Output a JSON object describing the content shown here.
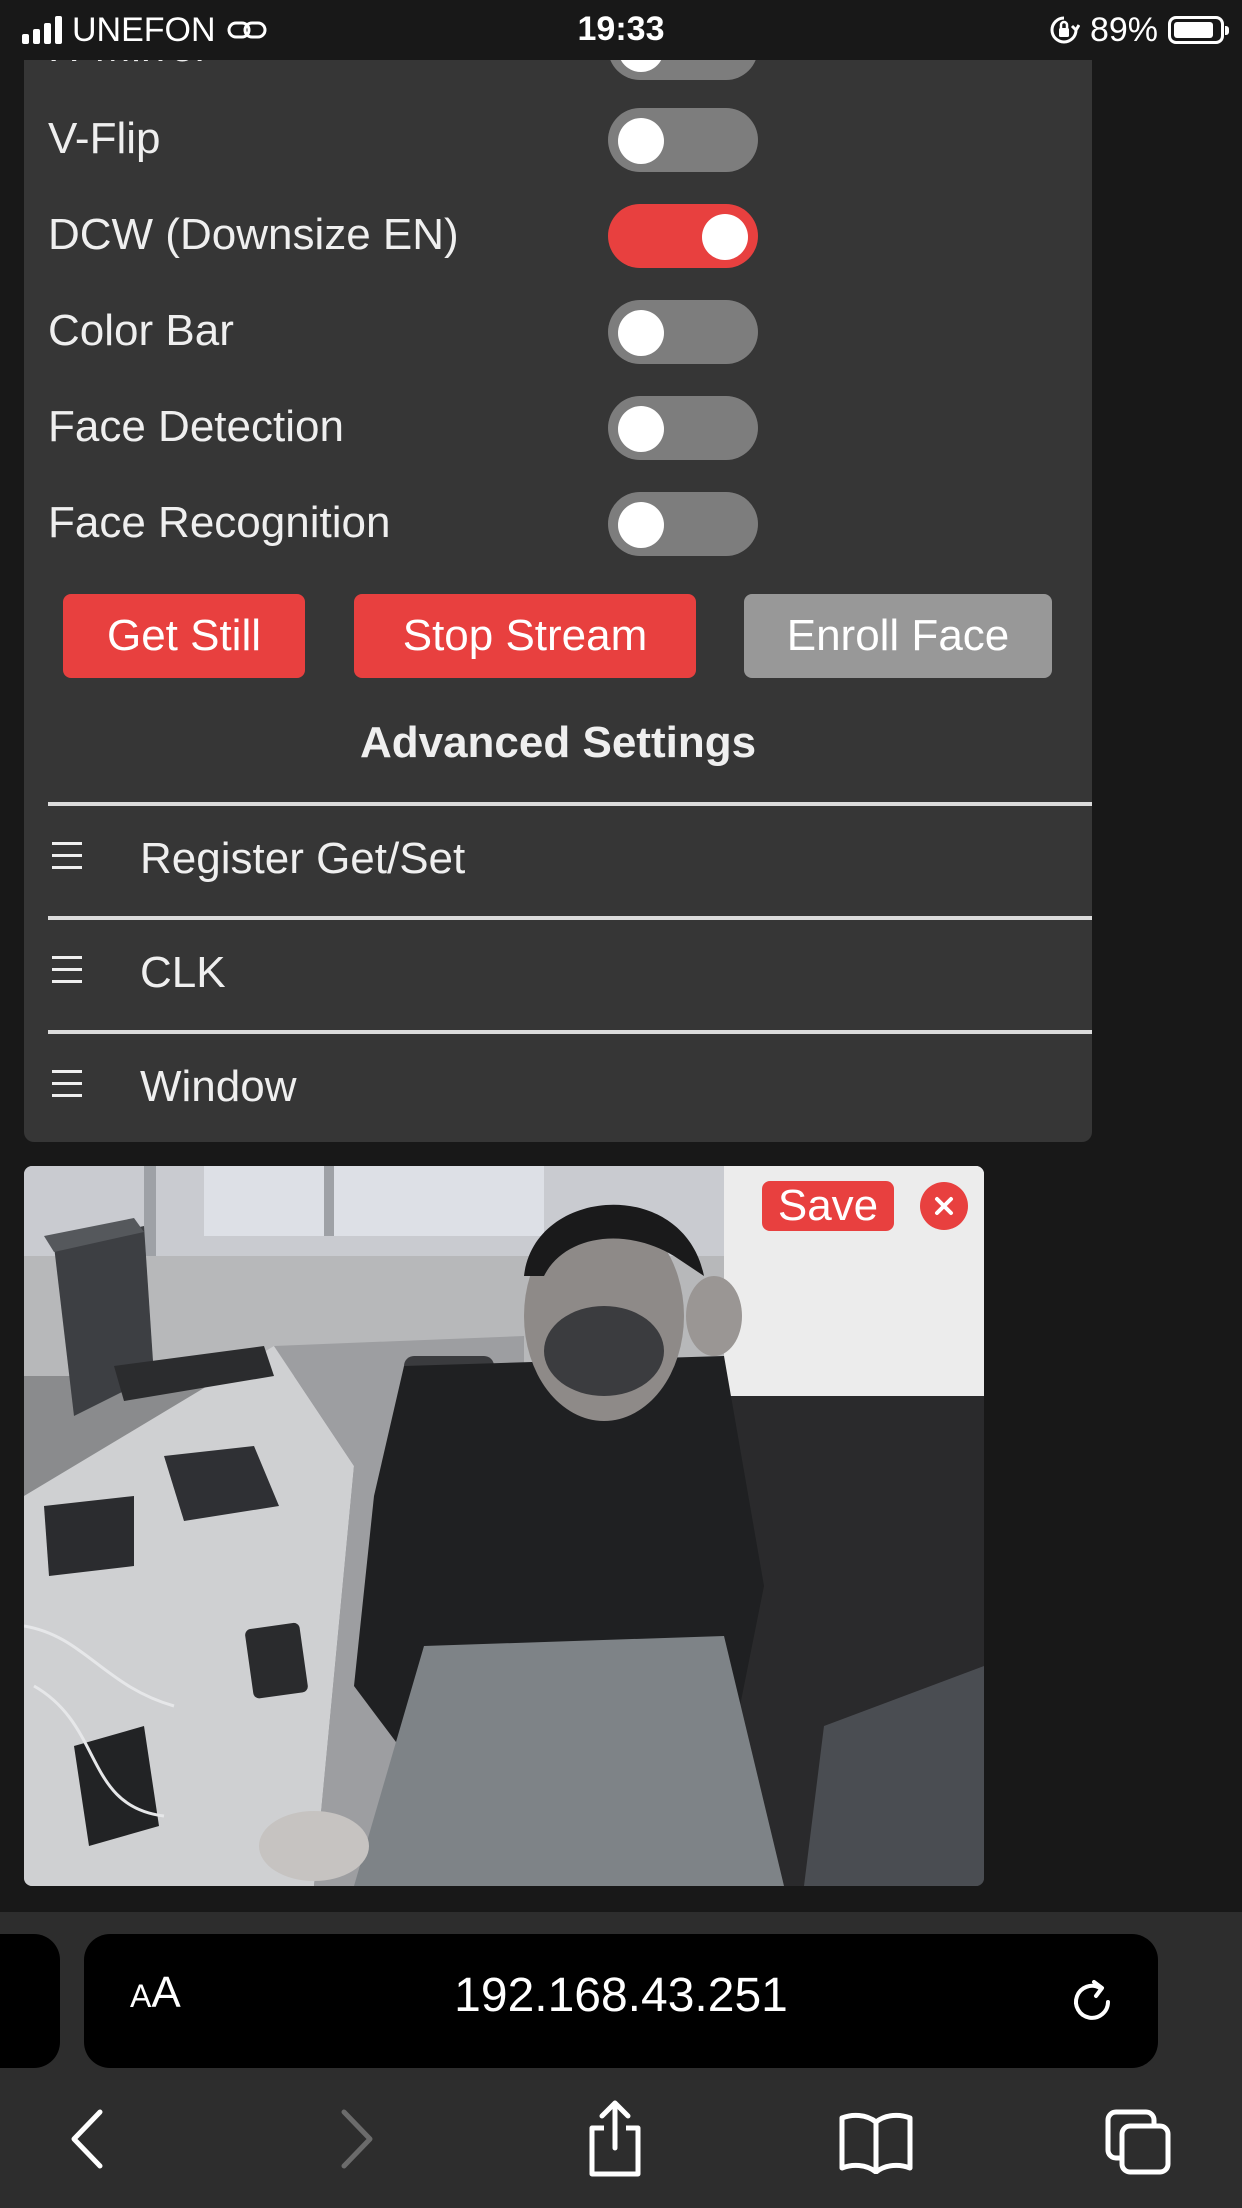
{
  "status_bar": {
    "carrier": "UNEFON",
    "time": "19:33",
    "battery_percent": "89%",
    "battery_level": 0.89
  },
  "controls": {
    "toggles": [
      {
        "label": "H-Mirror",
        "on": false
      },
      {
        "label": "V-Flip",
        "on": false
      },
      {
        "label": "DCW (Downsize EN)",
        "on": true
      },
      {
        "label": "Color Bar",
        "on": false
      },
      {
        "label": "Face Detection",
        "on": false
      },
      {
        "label": "Face Recognition",
        "on": false
      }
    ],
    "get_still": "Get Still",
    "stop_stream": "Stop Stream",
    "enroll_face": "Enroll Face"
  },
  "advanced": {
    "title": "Advanced Settings",
    "items": [
      "Register Get/Set",
      "CLK",
      "Window"
    ]
  },
  "stream": {
    "save_label": "Save",
    "close_icon": "close-icon"
  },
  "browser": {
    "text_size_small": "A",
    "text_size_large": "A",
    "url": "192.168.43.251",
    "icons": [
      "reload-icon",
      "back-icon",
      "forward-icon",
      "share-icon",
      "bookmarks-icon",
      "tabs-icon"
    ]
  },
  "colors": {
    "accent": "#e8403f",
    "panel_bg": "#363636",
    "page_bg": "#181818",
    "toggle_off": "#7d7d7d",
    "disabled_button": "#989898"
  }
}
